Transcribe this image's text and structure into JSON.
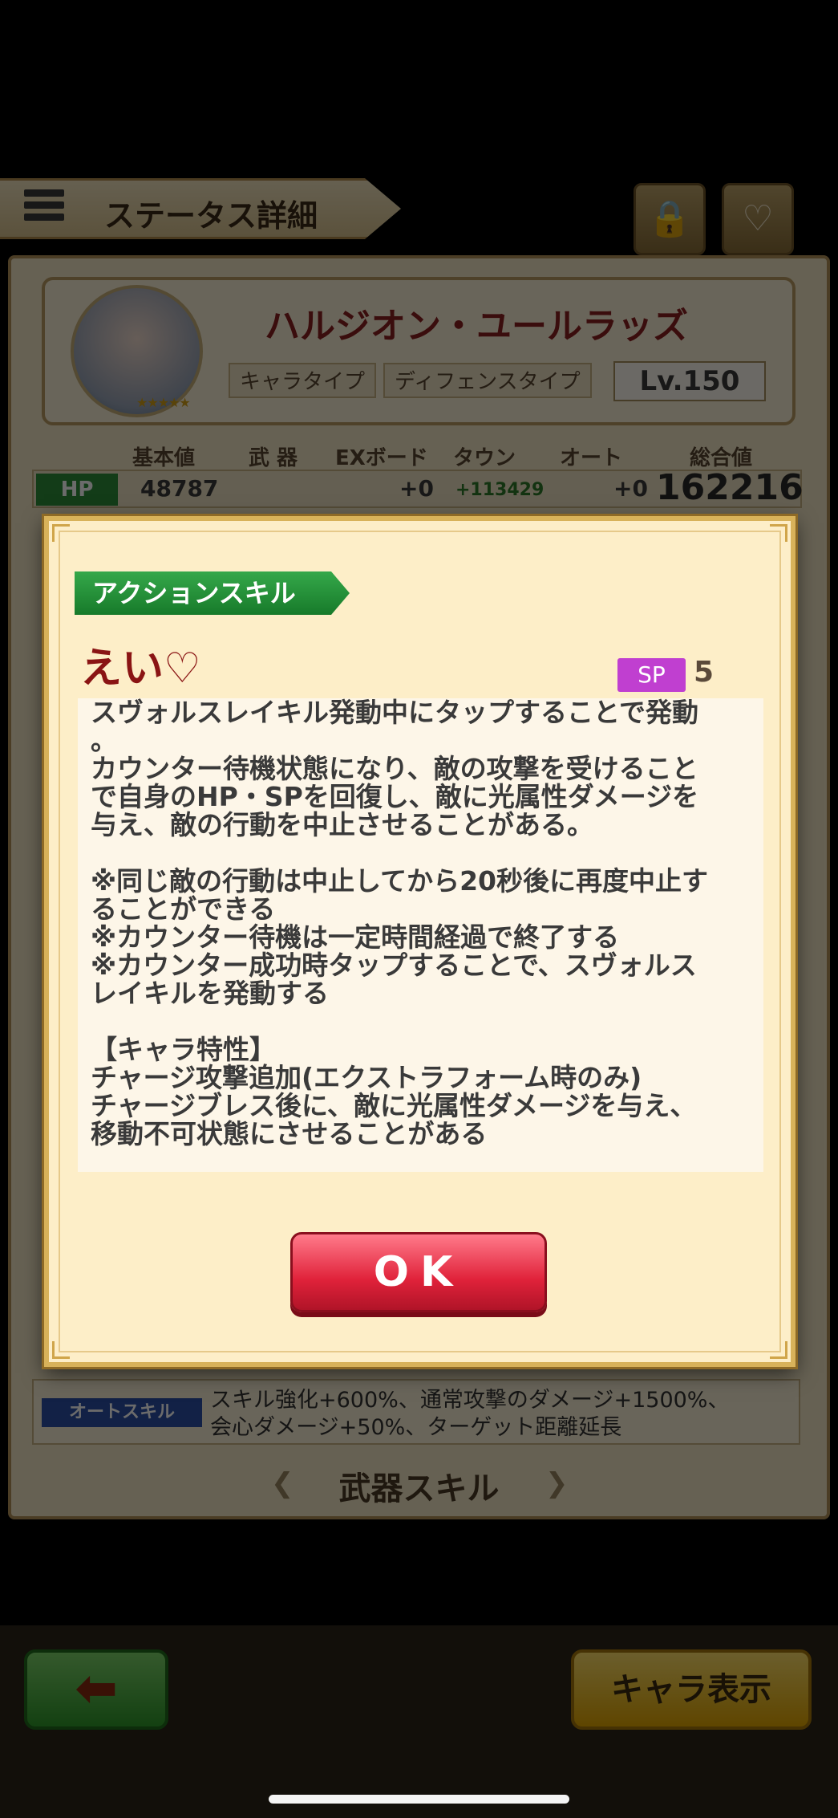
{
  "header": {
    "title": "ステータス詳細"
  },
  "character": {
    "name": "ハルジオン・ユールラッズ",
    "type_label": "キャラタイプ",
    "type_value": "ディフェンスタイプ",
    "level": "Lv.150",
    "rarity_stars": "★★★★★"
  },
  "stats": {
    "headers": [
      "基本値",
      "武 器",
      "EXボード",
      "タウン",
      "オート",
      "総合値"
    ],
    "hp": {
      "label": "HP",
      "base": "48787",
      "weapon": "",
      "ex_board": "+0",
      "town": "+113429",
      "auto": "+0",
      "total": "162216"
    }
  },
  "auto_skill": {
    "label": "オートスキル",
    "lines": [
      "スキル強化+600%、通常攻撃のダメージ+1500%、",
      "会心ダメージ+50%、ターゲット距離延長"
    ]
  },
  "weapon_skill": {
    "title": "武器スキル"
  },
  "bottom_bar": {
    "back_icon": "back-arrow-icon",
    "chara_button": "キャラ表示"
  },
  "modal": {
    "tag": "アクションスキル",
    "skill_name": "えい♡",
    "sp_label": "SP",
    "sp_value": "5",
    "description": [
      "スヴォルスレイキル発動中にタップすることで発動",
      "。",
      "カウンター待機状態になり、敵の攻撃を受けること",
      "で自身のHP・SPを回復し、敵に光属性ダメージを",
      "与え、敵の行動を中止させることがある。",
      "",
      "※同じ敵の行動は中止してから20秒後に再度中止す",
      "ることができる",
      "※カウンター待機は一定時間経過で終了する",
      "※カウンター成功時タップすることで、スヴォルス",
      "レイキルを発動する",
      "",
      "【キャラ特性】",
      "チャージ攻撃追加(エクストラフォーム時のみ)",
      "チャージブレス後に、敵に光属性ダメージを与え、",
      "移動不可状態にさせることがある"
    ],
    "ok_label": "OK"
  },
  "colors": {
    "modal_bg": "#fdeec8",
    "skill_tag": "#177a2a",
    "skill_name": "#8a1414",
    "sp_badge": "#c03fd0",
    "ok_button": "#e0223a"
  }
}
